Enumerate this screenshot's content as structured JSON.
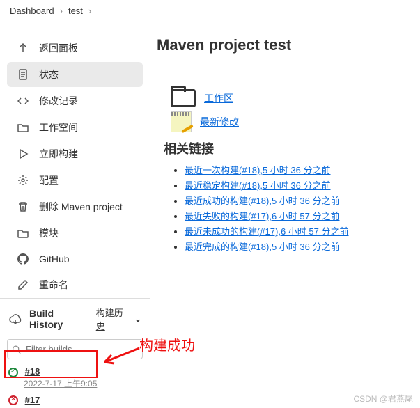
{
  "breadcrumb": {
    "items": [
      "Dashboard",
      "test"
    ]
  },
  "sidebar": {
    "items": [
      {
        "label": "返回面板"
      },
      {
        "label": "状态"
      },
      {
        "label": "修改记录"
      },
      {
        "label": "工作空间"
      },
      {
        "label": "立即构建"
      },
      {
        "label": "配置"
      },
      {
        "label": "删除 Maven project"
      },
      {
        "label": "模块"
      },
      {
        "label": "GitHub"
      },
      {
        "label": "重命名"
      }
    ]
  },
  "main": {
    "title": "Maven project test",
    "workspace_link": "工作区",
    "changes_link": "最新修改",
    "related_heading": "相关链接",
    "permalinks": [
      "最近一次构建(#18),5 小时 36 分之前",
      "最近稳定构建(#18),5 小时 36 分之前",
      "最近成功的构建(#18),5 小时 36 分之前",
      "最近失败的构建(#17),6 小时 57 分之前",
      "最近未成功的构建(#17),6 小时 57 分之前",
      "最近完成的构建(#18),5 小时 36 分之前"
    ]
  },
  "history": {
    "title": "Build History",
    "trend_link": "构建历史",
    "filter_placeholder": "Filter builds...",
    "builds": [
      {
        "num": "#18",
        "date": "2022-7-17 上午9:05",
        "status": "ok"
      },
      {
        "num": "#17",
        "date": "",
        "status": "fail"
      }
    ]
  },
  "annotation": {
    "text": "构建成功"
  },
  "watermark": "CSDN @君燕尾"
}
